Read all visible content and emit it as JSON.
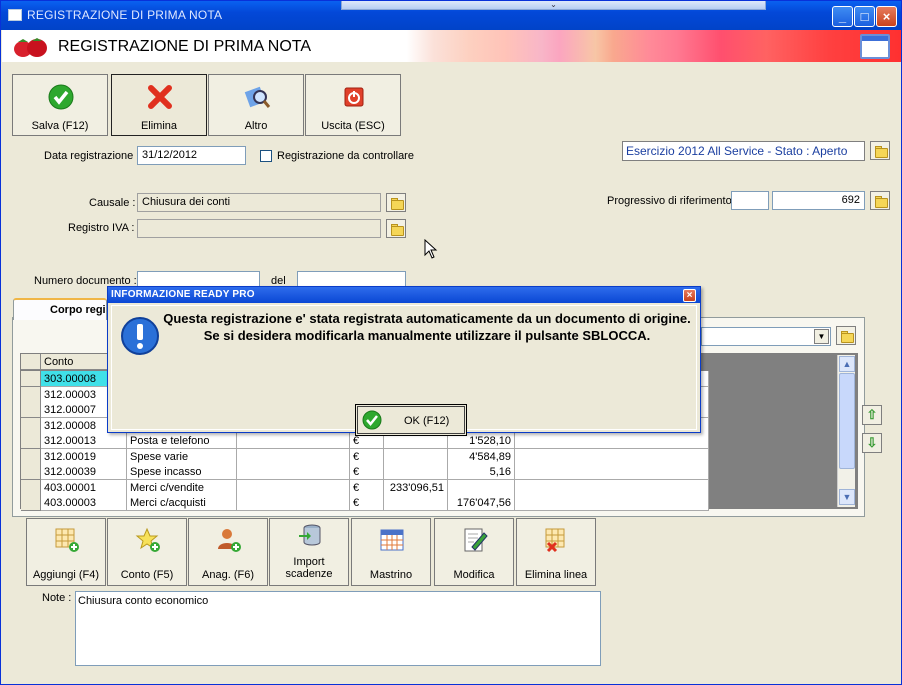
{
  "window": {
    "title": "REGISTRAZIONE DI PRIMA NOTA",
    "header_title": "REGISTRAZIONE DI PRIMA NOTA"
  },
  "toolbar": {
    "save_label": "Salva (F12)",
    "delete_label": "Elimina",
    "other_label": "Altro",
    "exit_label": "Uscita (ESC)"
  },
  "form": {
    "date_label": "Data registrazione :",
    "date_value": "31/12/2012",
    "to_check_label": "Registrazione da controllare",
    "exercise_text": "Esercizio 2012 All Service - Stato : Aperto",
    "causale_label": "Causale :",
    "causale_value": "Chiusura dei conti",
    "registro_label": "Registro IVA :",
    "registro_value": "",
    "progressivo_label": "Progressivo di riferimento :",
    "progressivo_value": "692",
    "numdoc_label": "Numero documento :",
    "del_label": "del"
  },
  "tab": {
    "label": "Corpo registrazione"
  },
  "grid": {
    "header_conto": "Conto",
    "rows": [
      {
        "conto": "303.00008",
        "desc": "",
        "cur": "",
        "dare": "",
        "avere": ""
      },
      {
        "conto": "312.00003",
        "desc": "",
        "cur": "",
        "dare": "",
        "avere": ""
      },
      {
        "conto": "312.00007",
        "desc": "",
        "cur": "",
        "dare": "",
        "avere": ""
      },
      {
        "conto": "312.00008",
        "desc": "",
        "cur": "",
        "dare": "",
        "avere": ""
      },
      {
        "conto": "312.00013",
        "desc": "Posta e telefono",
        "cur": "€",
        "dare": "",
        "avere": "1'528,10"
      },
      {
        "conto": "312.00019",
        "desc": "Spese varie",
        "cur": "€",
        "dare": "",
        "avere": "4'584,89"
      },
      {
        "conto": "312.00039",
        "desc": "Spese incasso",
        "cur": "€",
        "dare": "",
        "avere": "5,16"
      },
      {
        "conto": "403.00001",
        "desc": "Merci c/vendite",
        "cur": "€",
        "dare": "233'096,51",
        "avere": ""
      },
      {
        "conto": "403.00003",
        "desc": "Merci c/acquisti",
        "cur": "€",
        "dare": "",
        "avere": "176'047,56"
      }
    ]
  },
  "bottom_toolbar": {
    "add_label": "Aggiungi (F4)",
    "conto_label": "Conto (F5)",
    "anag_label": "Anag. (F6)",
    "import_label": "Import scadenze",
    "mastrino_label": "Mastrino",
    "modifica_label": "Modifica",
    "elimina_linea_label": "Elimina linea"
  },
  "notes": {
    "label": "Note :",
    "value": "Chiusura conto economico"
  },
  "dialog": {
    "title": "INFORMAZIONE READY PRO",
    "message": "Questa registrazione e' stata registrata automaticamente da un documento di origine. Se si desidera modificarla manualmente utilizzare il pulsante SBLOCCA.",
    "ok_label": "OK (F12)"
  }
}
